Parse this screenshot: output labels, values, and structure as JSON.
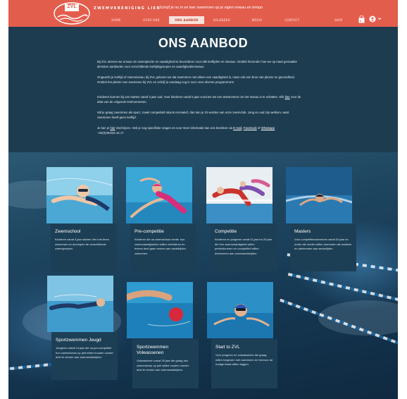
{
  "brand": {
    "logo_text": "ZVL",
    "name": "ZWEMVERENIGING LIER",
    "tagline": "Schrijf je nu in en leer zwemmen op je eigen niveau en tempo"
  },
  "nav": {
    "items": [
      {
        "label": "HOME"
      },
      {
        "label": "OVER ONS"
      },
      {
        "label": "ONS AANBOD"
      },
      {
        "label": "KALENDER"
      },
      {
        "label": "MEDIA"
      },
      {
        "label": "CONTACT"
      }
    ],
    "shop": "SHOP",
    "cart_count": "0"
  },
  "intro": {
    "title": "ONS AANBOD",
    "p1": "Bij ZVL streven we ernaar om zwemplezier en vaardigheid te bevorderen voor alle leeftijden en niveaus. Ontdek hieronder hoe we op maat gemaakte diensten aanbieden voor verschillende leeftijdsgroepen en vaardigheidsniveaus.",
    "p2": "Ongeacht je leeftijd of zwemniveau, bij ZVL geloven we dat zwemmen niet alleen een vaardigheid is, maar ook een bron van plezier en gezondheid. Ontdek het plezier van zwemmen bij ZVL en schrijf je vandaag nog in voor onze diverse programma's!",
    "p3_a": "Kinderen kunnen bij ons starten vanaf 3 jaar oud. Voor kinderen vanaf 5 jaar voorzien we een testmoment om het niveau in te schatten. Klik ",
    "p3_link": "hier",
    "p3_b": " voor de data van de volgende testmomenten.",
    "p4": "Wil je graag zwemmen als sport, zowel competitief alsook recreatief, dan kan je 10 worden van onze zwemclub. Jong en oud zijn welkom, want zwemmen heeft geen leeftijd.",
    "p5_a": "Je kan je ",
    "p5_link1": "hier",
    "p5_b": " inschrijven. Heb je nog specifieke vragen en voor meer informatie kan ons bereiken via ",
    "p5_link2": "E-mail",
    "p5_c": ", ",
    "p5_link3": "Facebook",
    "p5_d": " of ",
    "p5_link4": "Whatsapp",
    "p5_e": " +32(0)493/26.16.17"
  },
  "cards": [
    {
      "title": "Zwemschool",
      "desc": "Kinderen vanaf 3 jaar starten hier met leren zwemmen en doorlopen de verschillende zwemgroepen."
    },
    {
      "title": "Pre-competitie",
      "desc": "Kinderen die na zwemschool verder hun zwemvaardigheden willen verbeteren en tevens deel gaan nemen aan wedstrijden zwemmen."
    },
    {
      "title": "Competitie",
      "desc": "Kinderen en jongeren vanaf 11 jaar tot 20 jaar die hun zwemvaardigheid willen perfectioneren en competitief willen deelnemen aan zwemwedstrijden."
    },
    {
      "title": "Masters",
      "desc": "Voor competitiezwemmers vanaf 20 jaar en ouder die verder willen zwemmen als masters en deelnemen aan wedstrijden."
    },
    {
      "title": "Sportzwemmen Jeugd",
      "desc": "Jongeren vanaf 14 jaar die na pre-competitie hun zwemniveau op peil willen houden zonder deel te nemen aan zwemwedstrijden."
    },
    {
      "title": "Sportzwemmen Volwassenen",
      "desc": "Volwassenen vanaf 20 jaar die graag hun zwemniveau op peil willen houden zonder deel te nemen aan zwemwedstrijden."
    },
    {
      "title": "Start to ZVL",
      "desc": "Voor jongeren en volwassenen die graag willen beginnen met zwemmen en hiervoor de nodige basis willen leggen."
    }
  ]
}
